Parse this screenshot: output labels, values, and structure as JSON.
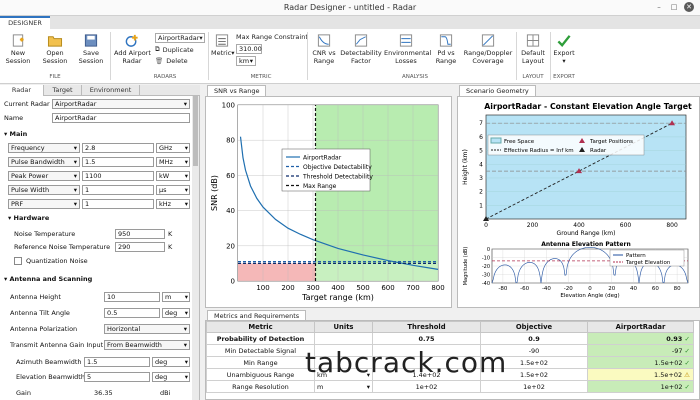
{
  "window": {
    "title": "Radar Designer - untitled - Radar"
  },
  "tabs": {
    "designer": "DESIGNER"
  },
  "ribbon": {
    "file": {
      "new": "New\nSession",
      "open": "Open\nSession",
      "save": "Save\nSession",
      "label": "FILE"
    },
    "radars": {
      "add": "Add Airport\nRadar",
      "current": "AirportRadar",
      "duplicate": "Duplicate",
      "delete": "Delete",
      "label": "RADARS"
    },
    "metric": {
      "metric": "Metric",
      "max_range_label": "Max Range Constraint",
      "max_range_value": "310.00",
      "max_range_unit": "km",
      "label": "METRIC"
    },
    "analysis": {
      "items": [
        "CNR vs\nRange",
        "Detectability\nFactor",
        "Environmental\nLosses",
        "Pd vs\nRange",
        "Range/Doppler\nCoverage"
      ],
      "label": "ANALYSIS"
    },
    "layout": {
      "default": "Default\nLayout",
      "label": "LAYOUT"
    },
    "export": {
      "export": "Export",
      "label": "EXPORT"
    }
  },
  "left": {
    "tabs": [
      "Radar",
      "Target",
      "Environment"
    ],
    "current_radar_label": "Current Radar",
    "current_radar_value": "AirportRadar",
    "name_label": "Name",
    "name_value": "AirportRadar",
    "main": "Main",
    "rows": [
      {
        "label": "Frequency",
        "value": "2.8",
        "unit": "GHz"
      },
      {
        "label": "Pulse Bandwidth",
        "value": "1.5",
        "unit": "MHz"
      },
      {
        "label": "Peak Power",
        "value": "1100",
        "unit": "kW"
      },
      {
        "label": "Pulse Width",
        "value": "1",
        "unit": "µs"
      },
      {
        "label": "PRF",
        "value": "1",
        "unit": "kHz"
      }
    ],
    "hardware": "Hardware",
    "noise_temp_label": "Noise Temperature",
    "noise_temp_value": "950",
    "noise_temp_unit": "K",
    "ref_noise_label": "Reference Noise Temperature",
    "ref_noise_value": "290",
    "ref_noise_unit": "K",
    "quant_noise": "Quantization Noise",
    "antenna": "Antenna and Scanning",
    "ant_height_label": "Antenna Height",
    "ant_height_value": "10",
    "ant_height_unit": "m",
    "ant_tilt_label": "Antenna Tilt Angle",
    "ant_tilt_value": "0.5",
    "ant_tilt_unit": "deg",
    "ant_pol_label": "Antenna Polarization",
    "ant_pol_value": "Horizontal",
    "tx_gain_label": "Transmit Antenna Gain Input",
    "tx_gain_value": "From Beamwidth",
    "az_bw_label": "Azimuth Beamwidth",
    "az_bw_value": "1.5",
    "az_bw_unit": "deg",
    "el_bw_label": "Elevation Beamwidth",
    "el_bw_value": "5",
    "el_bw_unit": "deg",
    "gain_label": "Gain",
    "gain_value": "36.35",
    "gain_unit": "dBi"
  },
  "panels": {
    "snr": "SNR vs Range",
    "geo": "Scenario Geometry",
    "metrics": "Metrics and Requirements"
  },
  "chart_data": [
    {
      "type": "line",
      "title": "",
      "xlabel": "Target range (km)",
      "ylabel": "SNR (dB)",
      "xlim": [
        0,
        800
      ],
      "ylim": [
        0,
        100
      ],
      "xticks": [
        100,
        200,
        300,
        400,
        500,
        600,
        700,
        800
      ],
      "yticks": [
        0,
        20,
        40,
        60,
        80,
        100
      ],
      "legend": {
        "placement": "center",
        "entries": [
          "AirportRadar",
          "Objective Detectability",
          "Threshold Detectability",
          "Max Range"
        ]
      },
      "series": [
        {
          "name": "AirportRadar",
          "x": [
            10,
            20,
            30,
            50,
            75,
            100,
            150,
            200,
            250,
            300,
            350,
            400,
            500,
            600,
            700,
            800
          ],
          "values": [
            82,
            70,
            63,
            54,
            47,
            42,
            35,
            30,
            26.5,
            23.5,
            21,
            18.5,
            14.8,
            11.6,
            8.9,
            6.6
          ]
        },
        {
          "name": "Objective Detectability",
          "x": [
            0,
            800
          ],
          "values": [
            11,
            11
          ]
        },
        {
          "name": "Threshold Detectability",
          "x": [
            0,
            800
          ],
          "values": [
            10,
            10
          ]
        },
        {
          "name": "Max Range",
          "x": [
            310,
            310
          ],
          "values": [
            0,
            100
          ]
        }
      ]
    },
    {
      "type": "line",
      "title": "AirportRadar - Constant Elevation Angle Target",
      "xlabel": "Ground Range (km)",
      "ylabel": "Height (km)",
      "xlim": [
        0,
        860
      ],
      "ylim": [
        0,
        7.6
      ],
      "xticks": [
        0,
        200,
        400,
        600,
        800
      ],
      "yticks": [
        1,
        2,
        3,
        4,
        5,
        6,
        7
      ],
      "legend": {
        "placement": "top",
        "entries": [
          "Free Space",
          "Effective Radius = Inf km",
          "Target Positions",
          "Radar"
        ]
      },
      "series": [
        {
          "name": "Effective Radius = Inf km",
          "x": [
            0,
            800
          ],
          "values": [
            0,
            7
          ]
        },
        {
          "name": "Target Positions",
          "x": [
            400,
            800
          ],
          "values": [
            3.5,
            7
          ]
        },
        {
          "name": "Radar",
          "x": [
            0
          ],
          "values": [
            0
          ]
        }
      ]
    },
    {
      "type": "line",
      "title": "Antenna Elevation Pattern",
      "xlabel": "Elevation Angle (deg)",
      "ylabel": "Magnitude (dB)",
      "xlim": [
        -90,
        90
      ],
      "ylim": [
        -40,
        0
      ],
      "xticks": [
        -80,
        -60,
        -40,
        -20,
        0,
        20,
        40,
        60,
        80
      ],
      "yticks": [
        -40,
        -30,
        -20,
        -10,
        0
      ],
      "legend": {
        "placement": "top-right",
        "entries": [
          "Pattern",
          "Target Elevation"
        ]
      },
      "series": [
        {
          "name": "Target Elevation",
          "x": [
            -90,
            90
          ],
          "values": [
            -14,
            -14
          ]
        }
      ]
    }
  ],
  "metrics": {
    "headers": [
      "Metric",
      "Units",
      "Threshold",
      "Objective",
      "AirportRadar"
    ],
    "rows": [
      {
        "metric": "Probability of Detection",
        "units": "",
        "threshold": "0.75",
        "objective": "0.9",
        "value": "0.93",
        "status": "✓",
        "bold": true,
        "color": "g"
      },
      {
        "metric": "Min Detectable Signal",
        "units": "",
        "threshold": "",
        "objective": "-90",
        "value": "-97",
        "status": "✓",
        "bold": false,
        "color": "g"
      },
      {
        "metric": "Min Range",
        "units": "",
        "threshold": "",
        "objective": "1.5e+02",
        "value": "1.5e+02",
        "status": "✓",
        "bold": false,
        "color": "g"
      },
      {
        "metric": "Unambiguous Range",
        "units": "km",
        "threshold": "1.4e+02",
        "objective": "1.5e+02",
        "value": "1.5e+02",
        "status": "⚠",
        "bold": false,
        "color": "y"
      },
      {
        "metric": "Range Resolution",
        "units": "m",
        "threshold": "1e+02",
        "objective": "1e+02",
        "value": "1e+02",
        "status": "✓",
        "bold": false,
        "color": "g"
      }
    ]
  },
  "watermark": "tabcrack.com"
}
